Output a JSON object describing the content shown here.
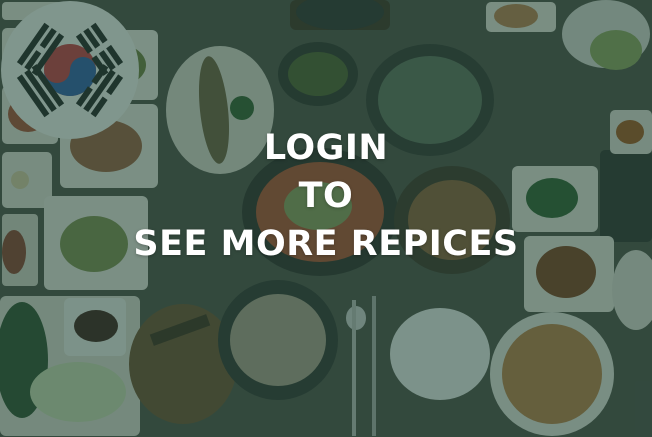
{
  "login_prompt": {
    "line1": "LOGIN",
    "line2": "TO",
    "line3": "SEE MORE REPICES"
  },
  "colors": {
    "overlay": "#20483a",
    "text": "#ffffff",
    "flag_red": "#c8363d",
    "flag_blue": "#2a5aa8"
  }
}
